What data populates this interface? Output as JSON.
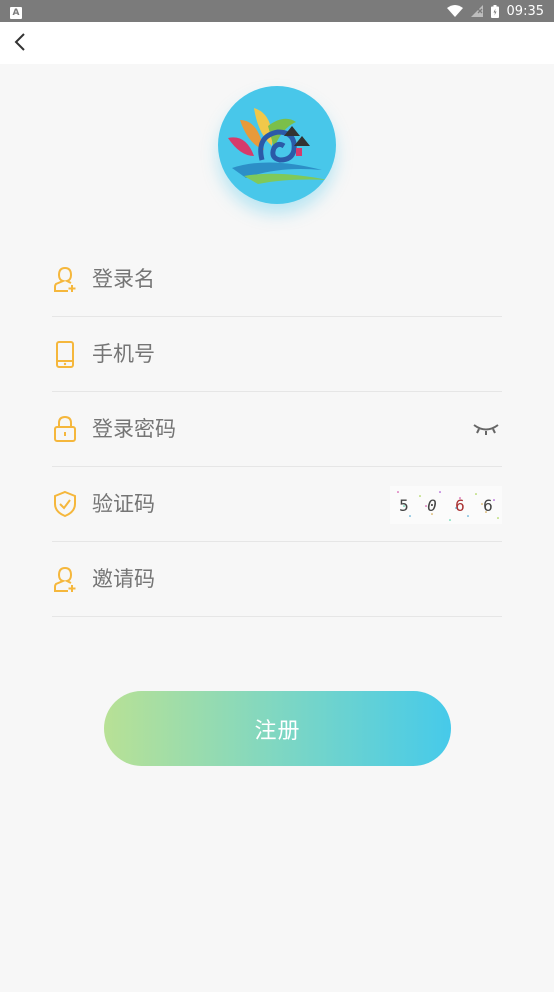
{
  "status_bar": {
    "left_badge": "A",
    "time": "09:35"
  },
  "nav": {
    "back_icon": "chevron-left-icon"
  },
  "form": {
    "username_placeholder": "登录名",
    "phone_placeholder": "手机号",
    "password_placeholder": "登录密码",
    "captcha_placeholder": "验证码",
    "invite_placeholder": "邀请码",
    "captcha_chars": [
      "5",
      "0",
      "6",
      "6"
    ]
  },
  "submit": {
    "label": "注册"
  },
  "colors": {
    "accent_icon": "#f5b73c",
    "logo_bg": "#48c7ea",
    "button_start": "#b8e195",
    "button_end": "#46caea"
  }
}
